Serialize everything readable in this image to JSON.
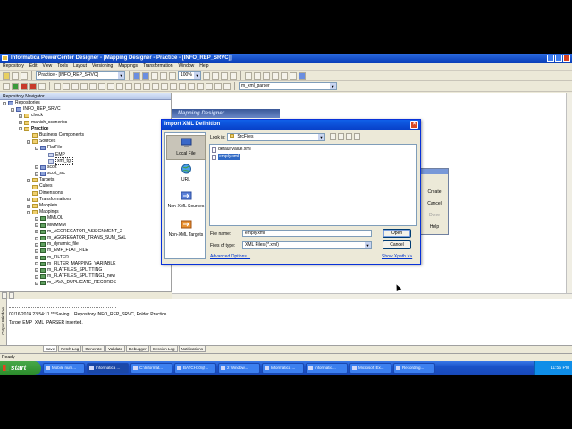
{
  "app": {
    "title": "Informatica PowerCenter Designer - [Mapping Designer - Practice - [INFO_REP_SRVC]]"
  },
  "menu": [
    "Repository",
    "Edit",
    "View",
    "Tools",
    "Layout",
    "Versioning",
    "Mappings",
    "Transformation",
    "Window",
    "Help"
  ],
  "toolbar": {
    "folder_combo": "Practice - [INFO_REP_SRVC]",
    "zoom": "100%",
    "mapping_combo": "m_xml_parser"
  },
  "navigator": {
    "title": "Repository Navigator",
    "tree": [
      {
        "label": "Repositories",
        "level": 0,
        "icon": "db",
        "exp": "-"
      },
      {
        "label": "INFO_REP_SRVC",
        "level": 1,
        "icon": "db",
        "exp": "-"
      },
      {
        "label": "check",
        "level": 2,
        "icon": "folder",
        "exp": "+"
      },
      {
        "label": "manish_scenerios",
        "level": 2,
        "icon": "folder",
        "exp": "+"
      },
      {
        "label": "Practice",
        "level": 2,
        "icon": "folder",
        "exp": "-",
        "bold": true
      },
      {
        "label": "Business Components",
        "level": 3,
        "icon": "folder",
        "exp": ""
      },
      {
        "label": "Sources",
        "level": 3,
        "icon": "folder",
        "exp": "-"
      },
      {
        "label": "FlatFile",
        "level": 4,
        "icon": "db",
        "exp": "-"
      },
      {
        "label": "EMP",
        "level": 5,
        "icon": "src",
        "exp": ""
      },
      {
        "label": "xml_tgt",
        "level": 5,
        "icon": "src",
        "exp": "",
        "selected": true
      },
      {
        "label": "scott",
        "level": 4,
        "icon": "db",
        "exp": "+"
      },
      {
        "label": "scott_src",
        "level": 4,
        "icon": "db",
        "exp": "+"
      },
      {
        "label": "Targets",
        "level": 3,
        "icon": "folder",
        "exp": "+"
      },
      {
        "label": "Cubes",
        "level": 3,
        "icon": "folder",
        "exp": ""
      },
      {
        "label": "Dimensions",
        "level": 3,
        "icon": "folder",
        "exp": ""
      },
      {
        "label": "Transformations",
        "level": 3,
        "icon": "folder",
        "exp": "+"
      },
      {
        "label": "Mapplets",
        "level": 3,
        "icon": "folder",
        "exp": "+"
      },
      {
        "label": "Mappings",
        "level": 3,
        "icon": "folder",
        "exp": "-"
      },
      {
        "label": "MMLOL",
        "level": 4,
        "icon": "map",
        "exp": "+"
      },
      {
        "label": "MMMMM",
        "level": 4,
        "icon": "map",
        "exp": "+"
      },
      {
        "label": "m_AGGREGATOR_ASSIGNMENT_2",
        "level": 4,
        "icon": "map",
        "exp": "+"
      },
      {
        "label": "m_AGGREGATOR_TRANS_SUM_SAL",
        "level": 4,
        "icon": "map",
        "exp": "+"
      },
      {
        "label": "m_dynamic_file",
        "level": 4,
        "icon": "map",
        "exp": "+"
      },
      {
        "label": "m_EMP_FLAT_FILE",
        "level": 4,
        "icon": "map",
        "exp": "+"
      },
      {
        "label": "m_FILTER",
        "level": 4,
        "icon": "map",
        "exp": "+"
      },
      {
        "label": "m_FILTER_MAPPING_VARIABLE",
        "level": 4,
        "icon": "map",
        "exp": "+"
      },
      {
        "label": "m_FLATFILES_SPLITTING",
        "level": 4,
        "icon": "map",
        "exp": "+"
      },
      {
        "label": "m_FLATFILES_SPLITTING1_new",
        "level": 4,
        "icon": "map",
        "exp": "+"
      },
      {
        "label": "m_JAVA_DUPLICATE_RECORDS",
        "level": 4,
        "icon": "map",
        "exp": "+"
      }
    ]
  },
  "workspace": {
    "banner": "Mapping Designer"
  },
  "bg_dialog": {
    "buttons": [
      {
        "label": "Create",
        "enabled": true
      },
      {
        "label": "Cancel",
        "enabled": true
      },
      {
        "label": "Done",
        "enabled": false
      },
      {
        "label": "Help",
        "enabled": true
      }
    ]
  },
  "dialog": {
    "title": "Import XML Definition",
    "close": "×",
    "places": [
      {
        "label": "Local File",
        "selected": true
      },
      {
        "label": "URL",
        "selected": false
      },
      {
        "label": "Non-XML Sources",
        "selected": false
      },
      {
        "label": "Non-XML Targets",
        "selected": false
      }
    ],
    "look_in_label": "Look in:",
    "look_in_value": "SrcFiles",
    "files": [
      {
        "name": "defaultValue.xml",
        "selected": false
      },
      {
        "name": "emply.xml",
        "selected": true
      }
    ],
    "file_name_label": "File name:",
    "file_name_value": "emply.xml",
    "file_type_label": "Files of type:",
    "file_type_value": "XML Files (*.xml)",
    "open_button": "Open",
    "cancel_button": "Cancel",
    "advanced_link": "Advanced Options...",
    "show_xpath_link": "Show Xpath >>"
  },
  "output": {
    "side_label": "Output Window",
    "lines": [
      "02/16/2014 23:54:11 ** Saving... Repository INFO_REP_SRVC, Folder Practice",
      "Target EMP_XML_PARSER inserted."
    ],
    "tabs": [
      "Save",
      "Fetch Log",
      "Generate",
      "Validate",
      "Debugger",
      "Session Log",
      "Notifications"
    ]
  },
  "status": {
    "text": "Ready"
  },
  "taskbar": {
    "start": "start",
    "buttons": [
      {
        "label": "Mobile num...",
        "active": false
      },
      {
        "label": "Informatica ...",
        "active": true
      },
      {
        "label": "C:\\Informat...",
        "active": false
      },
      {
        "label": "BATCH10@...",
        "active": false
      },
      {
        "label": "2 Window...",
        "active": false
      },
      {
        "label": "Informatica ...",
        "active": false
      },
      {
        "label": "Informatio...",
        "active": false
      },
      {
        "label": "Microsoft Ex...",
        "active": false
      },
      {
        "label": "Recording...",
        "active": false
      }
    ],
    "clock": "11:56 PM"
  },
  "colors": {
    "titlebar": "#0a3fb8",
    "dialog_title": "#0840c8",
    "selection": "#316ac5",
    "taskbar": "#1a52c8",
    "start": "#2a8a2a"
  }
}
